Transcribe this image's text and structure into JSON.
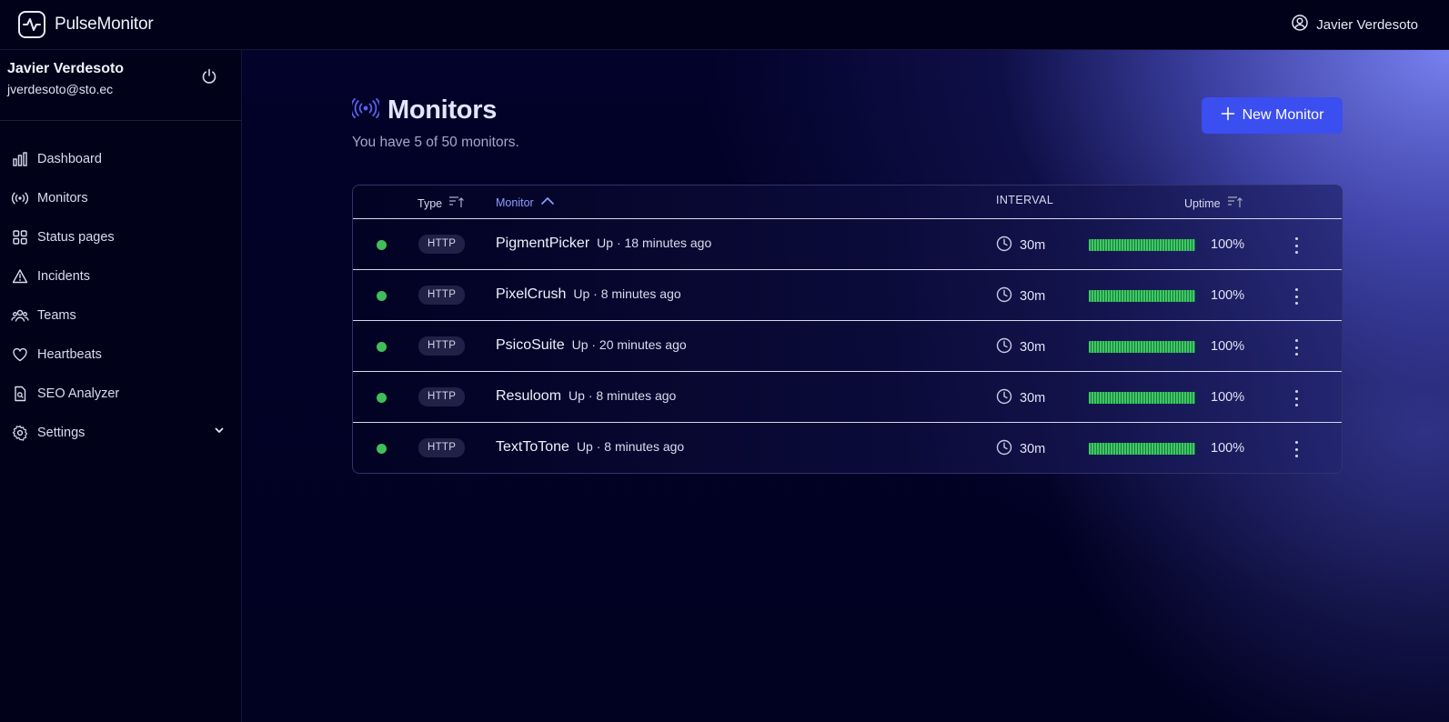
{
  "app": {
    "name": "PulseMonitor"
  },
  "topbar": {
    "user_name": "Javier Verdesoto"
  },
  "sidebar": {
    "user_name": "Javier Verdesoto",
    "user_email": "jverdesoto@sto.ec",
    "items": [
      {
        "label": "Dashboard",
        "icon": "bar-chart-icon"
      },
      {
        "label": "Monitors",
        "icon": "broadcast-icon"
      },
      {
        "label": "Status pages",
        "icon": "grid-icon"
      },
      {
        "label": "Incidents",
        "icon": "warning-triangle-icon"
      },
      {
        "label": "Teams",
        "icon": "users-icon"
      },
      {
        "label": "Heartbeats",
        "icon": "heart-icon"
      },
      {
        "label": "SEO Analyzer",
        "icon": "document-search-icon"
      },
      {
        "label": "Settings",
        "icon": "gear-icon"
      }
    ]
  },
  "page": {
    "title": "Monitors",
    "subtitle": "You have 5 of 50 monitors.",
    "new_button_label": "New Monitor"
  },
  "table": {
    "columns": {
      "type": "Type",
      "monitor": "Monitor",
      "interval": "INTERVAL",
      "uptime": "Uptime"
    },
    "rows": [
      {
        "type": "HTTP",
        "name": "PigmentPicker",
        "status": "Up · 18 minutes ago",
        "interval": "30m",
        "uptime": "100%",
        "uptime_fraction": 1.0
      },
      {
        "type": "HTTP",
        "name": "PixelCrush",
        "status": "Up · 8 minutes ago",
        "interval": "30m",
        "uptime": "100%",
        "uptime_fraction": 1.0
      },
      {
        "type": "HTTP",
        "name": "PsicoSuite",
        "status": "Up · 20 minutes ago",
        "interval": "30m",
        "uptime": "100%",
        "uptime_fraction": 1.0
      },
      {
        "type": "HTTP",
        "name": "Resuloom",
        "status": "Up · 8 minutes ago",
        "interval": "30m",
        "uptime": "100%",
        "uptime_fraction": 1.0
      },
      {
        "type": "HTTP",
        "name": "TextToTone",
        "status": "Up · 8 minutes ago",
        "interval": "30m",
        "uptime": "100%",
        "uptime_fraction": 1.0
      }
    ]
  },
  "colors": {
    "accent": "#3b4ef0",
    "status_up": "#3fbf5a",
    "sort_active": "#8f9cff"
  }
}
